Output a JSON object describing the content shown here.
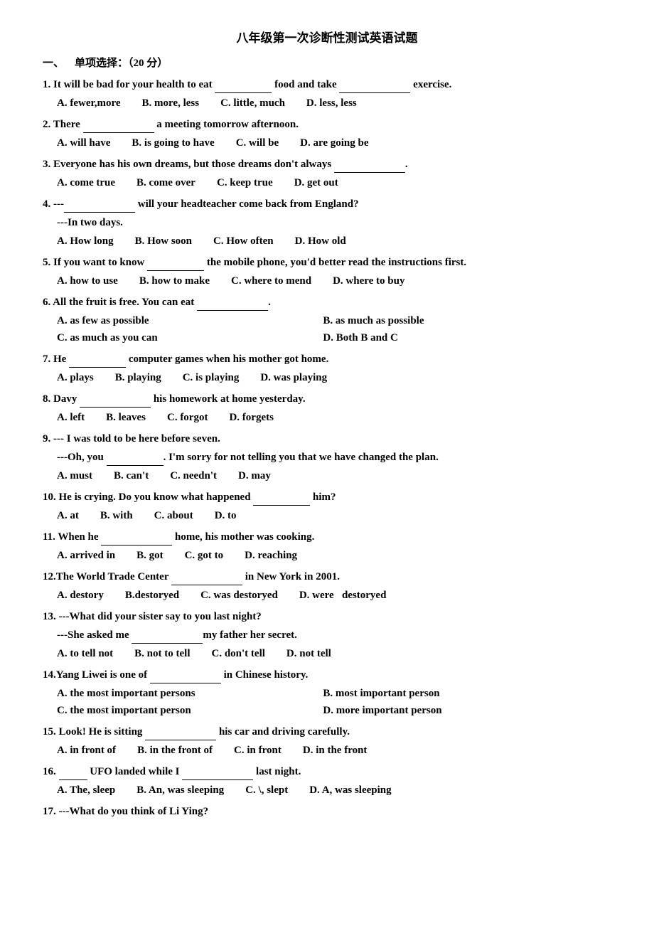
{
  "title": "八年级第一次诊断性测试英语试题",
  "section1": {
    "label": "一、",
    "title": "单项选择：（20 分）"
  },
  "questions": [
    {
      "id": "1",
      "text": "1. It will be bad for your health to eat _______ food and take _________ exercise.",
      "options": [
        "A. fewer,more",
        "B. more, less",
        "C. little, much",
        "D. less, less"
      ]
    },
    {
      "id": "2",
      "text": "2. There _________ a meeting tomorrow afternoon.",
      "options": [
        "A. will have",
        "B. is going to have",
        "C. will be",
        "D. are going be"
      ]
    },
    {
      "id": "3",
      "text": "3. Everyone has his own dreams, but those dreams don't always _________.",
      "options": [
        "A. come true",
        "B. come over",
        "C. keep true",
        "D. get out"
      ]
    },
    {
      "id": "4",
      "text": "4. ---_________ will your headteacher come back from England?",
      "sub": "---In two days.",
      "options": [
        "A. How long",
        "B. How soon",
        "C. How often",
        "D. How old"
      ]
    },
    {
      "id": "5",
      "text": "5. If you want to know ________ the mobile phone, you'd better read the instructions first.",
      "options": [
        "A. how to use",
        "B. how to make",
        "C. where to mend",
        "D. where to buy"
      ]
    },
    {
      "id": "6",
      "text": "6. All the fruit is free. You can eat ________.",
      "options2col": [
        "A. as few as possible",
        "B. as much as possible",
        "C. as much as you can",
        "D. Both B and C"
      ]
    },
    {
      "id": "7",
      "text": "7. He _______ computer games when his mother got home.",
      "options": [
        "A. plays",
        "B. playing",
        "C. is playing",
        "D. was playing"
      ]
    },
    {
      "id": "8",
      "text": "8. Davy ________ his homework at home yesterday.",
      "options": [
        "A. left",
        "B. leaves",
        "C. forgot",
        "D. forgets"
      ]
    },
    {
      "id": "9",
      "text": "9. --- I was told to be here before seven.",
      "sub": "---Oh, you ______. I'm sorry for not telling you that we have changed the plan.",
      "options": [
        "A. must",
        "B. can't",
        "C. needn't",
        "D. may"
      ]
    },
    {
      "id": "10",
      "text": "10. He is crying. Do you know what happened _______ him?",
      "options": [
        "A. at",
        "B. with",
        "C. about",
        "D. to"
      ]
    },
    {
      "id": "11",
      "text": "11. When he ________ home, his mother was cooking.",
      "options": [
        "A. arrived in",
        "B. got",
        "C. got to",
        "D. reaching"
      ]
    },
    {
      "id": "12",
      "text": "12.The World Trade Center ________ in New York in 2001.",
      "options": [
        "A. destory",
        "B.destoryed",
        "C. was destoryed",
        "D. were   destoryed"
      ]
    },
    {
      "id": "13",
      "text": "13. ---What did your sister say to you last night?",
      "sub": "---She asked me __________my father her secret.",
      "options": [
        "A. to tell not",
        "B. not to tell",
        "C. don't tell",
        "D. not tell"
      ]
    },
    {
      "id": "14",
      "text": "14.Yang Liwei is one of ________ in Chinese history.",
      "options2col": [
        "A. the most important persons",
        "B. most important person",
        "C. the most important person",
        "D. more important person"
      ]
    },
    {
      "id": "15",
      "text": "15. Look! He is sitting _________ his car and driving carefully.",
      "options": [
        "A. in front of",
        "B. in the front of",
        "C. in front",
        "D. in the front"
      ]
    },
    {
      "id": "16",
      "text": "16. _______ UFO landed while I _________ last night.",
      "options": [
        "A. The, sleep",
        "B. An, was sleeping",
        "C. \\, slept",
        "D. A, was sleeping"
      ]
    },
    {
      "id": "17",
      "text": "17. ---What do you think of Li Ying?"
    }
  ]
}
